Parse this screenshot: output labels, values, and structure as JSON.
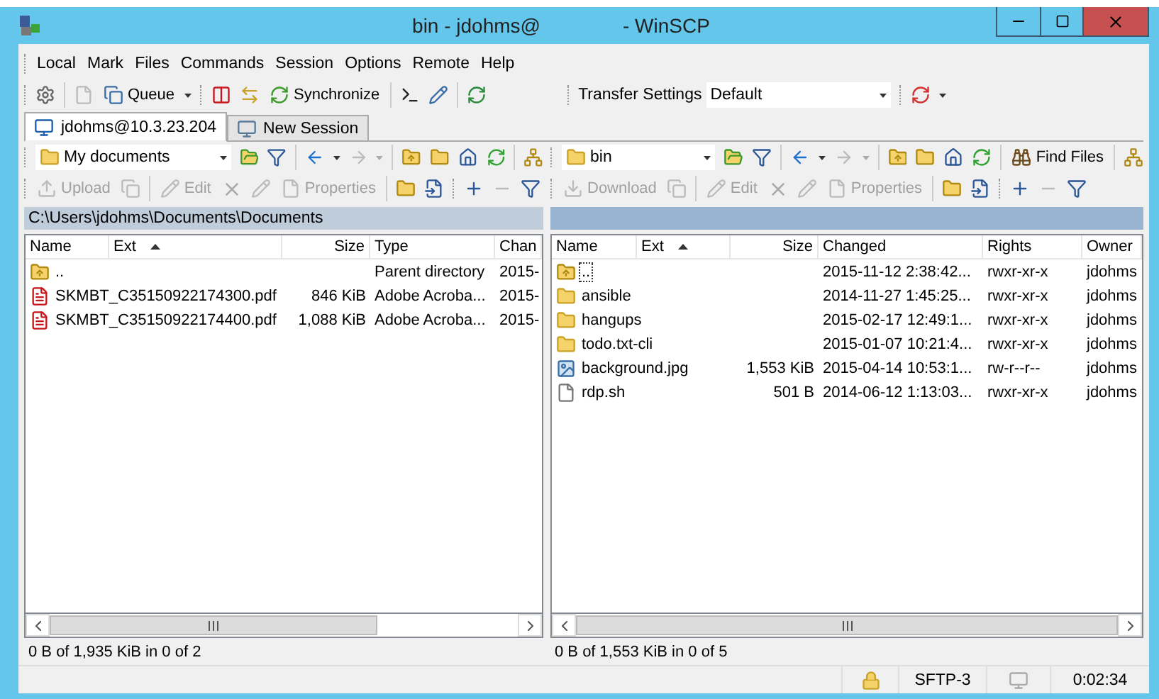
{
  "window": {
    "title_left": "bin - jdohms@",
    "title_right": "- WinSCP"
  },
  "menu": [
    "Local",
    "Mark",
    "Files",
    "Commands",
    "Session",
    "Options",
    "Remote",
    "Help"
  ],
  "toolbar": {
    "queue": "Queue",
    "synchronize": "Synchronize",
    "transfer_settings_label": "Transfer Settings",
    "transfer_settings_value": "Default"
  },
  "tabs": [
    {
      "label": "jdohms@10.3.23.204",
      "selected": true,
      "kind": "session"
    },
    {
      "label": "New Session",
      "selected": false,
      "kind": "new"
    }
  ],
  "panels": [
    {
      "active": false,
      "location": "My documents",
      "actions": [
        {
          "label": "Upload",
          "disabled": true
        },
        {
          "label": "Edit",
          "disabled": true
        },
        {
          "label": "Properties",
          "disabled": true
        }
      ],
      "path": "C:\\Users\\jdohms\\Documents\\Documents",
      "columns": [
        {
          "label": "Name",
          "sorted": false
        },
        {
          "label": "Ext",
          "sorted": true
        },
        {
          "label": "Size",
          "sorted": false
        },
        {
          "label": "Type",
          "sorted": false
        },
        {
          "label": "Chan",
          "sorted": false
        }
      ],
      "rows": [
        {
          "kind": "parent",
          "focused": false,
          "cells": [
            "..",
            "",
            "",
            "Parent directory",
            "2015-"
          ]
        },
        {
          "kind": "pdf",
          "focused": false,
          "cells": [
            "SKMBT_C35150922174300.pdf",
            "",
            "846 KiB",
            "Adobe Acroba...",
            "2015-"
          ]
        },
        {
          "kind": "pdf",
          "focused": false,
          "cells": [
            "SKMBT_C35150922174400.pdf",
            "",
            "1,088 KiB",
            "Adobe Acroba...",
            "2015-"
          ]
        }
      ],
      "status": "0 B of 1,935 KiB in 0 of 2"
    },
    {
      "active": true,
      "location": "bin",
      "find_files": "Find Files",
      "actions": [
        {
          "label": "Download",
          "disabled": true
        },
        {
          "label": "Edit",
          "disabled": true
        },
        {
          "label": "Properties",
          "disabled": true
        }
      ],
      "columns": [
        {
          "label": "Name",
          "sorted": false
        },
        {
          "label": "Ext",
          "sorted": true
        },
        {
          "label": "Size",
          "sorted": false
        },
        {
          "label": "Changed",
          "sorted": false
        },
        {
          "label": "Rights",
          "sorted": false
        },
        {
          "label": "Owner",
          "sorted": false
        }
      ],
      "rows": [
        {
          "kind": "parent",
          "focused": true,
          "cells": [
            "..",
            "",
            "",
            "2015-11-12 2:38:42...",
            "rwxr-xr-x",
            "jdohms"
          ]
        },
        {
          "kind": "folder",
          "focused": false,
          "cells": [
            "ansible",
            "",
            "",
            "2014-11-27 1:45:25...",
            "rwxr-xr-x",
            "jdohms"
          ]
        },
        {
          "kind": "folder",
          "focused": false,
          "cells": [
            "hangups",
            "",
            "",
            "2015-02-17 12:49:1...",
            "rwxr-xr-x",
            "jdohms"
          ]
        },
        {
          "kind": "folder",
          "focused": false,
          "cells": [
            "todo.txt-cli",
            "",
            "",
            "2015-01-07 10:21:4...",
            "rwxr-xr-x",
            "jdohms"
          ]
        },
        {
          "kind": "image",
          "focused": false,
          "cells": [
            "background.jpg",
            "",
            "1,553 KiB",
            "2015-04-14 10:53:1...",
            "rw-r--r--",
            "jdohms"
          ]
        },
        {
          "kind": "file",
          "focused": false,
          "cells": [
            "rdp.sh",
            "",
            "501 B",
            "2014-06-12 1:13:03...",
            "rwxr-xr-x",
            "jdohms"
          ]
        }
      ],
      "status": "0 B of 1,553 KiB in 0 of 5"
    }
  ],
  "status_bar": {
    "protocol": "SFTP-3",
    "elapsed": "0:02:34"
  }
}
